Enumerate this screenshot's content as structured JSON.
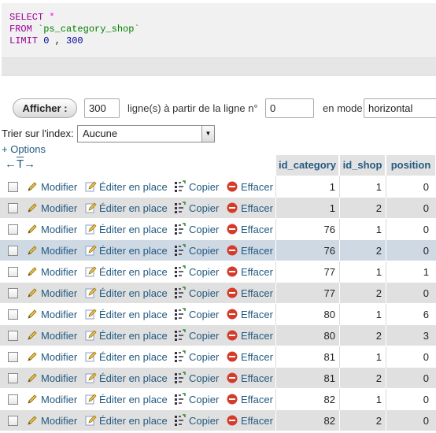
{
  "sql": {
    "select_kw": "SELECT",
    "select_op": " *",
    "from_kw": "FROM",
    "table": " `ps_category_shop`",
    "limit_kw": "LIMIT",
    "limit_a": " 0",
    "limit_sep": " , ",
    "limit_b": "300"
  },
  "nav": {
    "show_button": "Afficher :",
    "rows_value": "300",
    "rows_label": "ligne(s) à partir de la ligne n°",
    "start_value": "0",
    "mode_label": "en mode",
    "mode_value": "horizontal"
  },
  "sort": {
    "label": "Trier sur l'index:",
    "value": "Aucune"
  },
  "options_link": "+ Options",
  "table": {
    "headers": [
      "id_category",
      "id_shop",
      "position"
    ],
    "actions": {
      "modify": "Modifier",
      "edit_inline": "Éditer en place",
      "copy": "Copier",
      "delete": "Effacer"
    },
    "rows": [
      {
        "id_category": "1",
        "id_shop": "1",
        "position": "0"
      },
      {
        "id_category": "1",
        "id_shop": "2",
        "position": "0"
      },
      {
        "id_category": "76",
        "id_shop": "1",
        "position": "0"
      },
      {
        "id_category": "76",
        "id_shop": "2",
        "position": "0"
      },
      {
        "id_category": "77",
        "id_shop": "1",
        "position": "1"
      },
      {
        "id_category": "77",
        "id_shop": "2",
        "position": "0"
      },
      {
        "id_category": "80",
        "id_shop": "1",
        "position": "6"
      },
      {
        "id_category": "80",
        "id_shop": "2",
        "position": "3"
      },
      {
        "id_category": "81",
        "id_shop": "1",
        "position": "0"
      },
      {
        "id_category": "81",
        "id_shop": "2",
        "position": "0"
      },
      {
        "id_category": "82",
        "id_shop": "1",
        "position": "0"
      },
      {
        "id_category": "82",
        "id_shop": "2",
        "position": "0"
      }
    ]
  },
  "colors": {
    "link": "#235a81",
    "keyword": "#990099",
    "row_highlight": "#cfd9e4",
    "delete_red": "#d43b2b"
  }
}
